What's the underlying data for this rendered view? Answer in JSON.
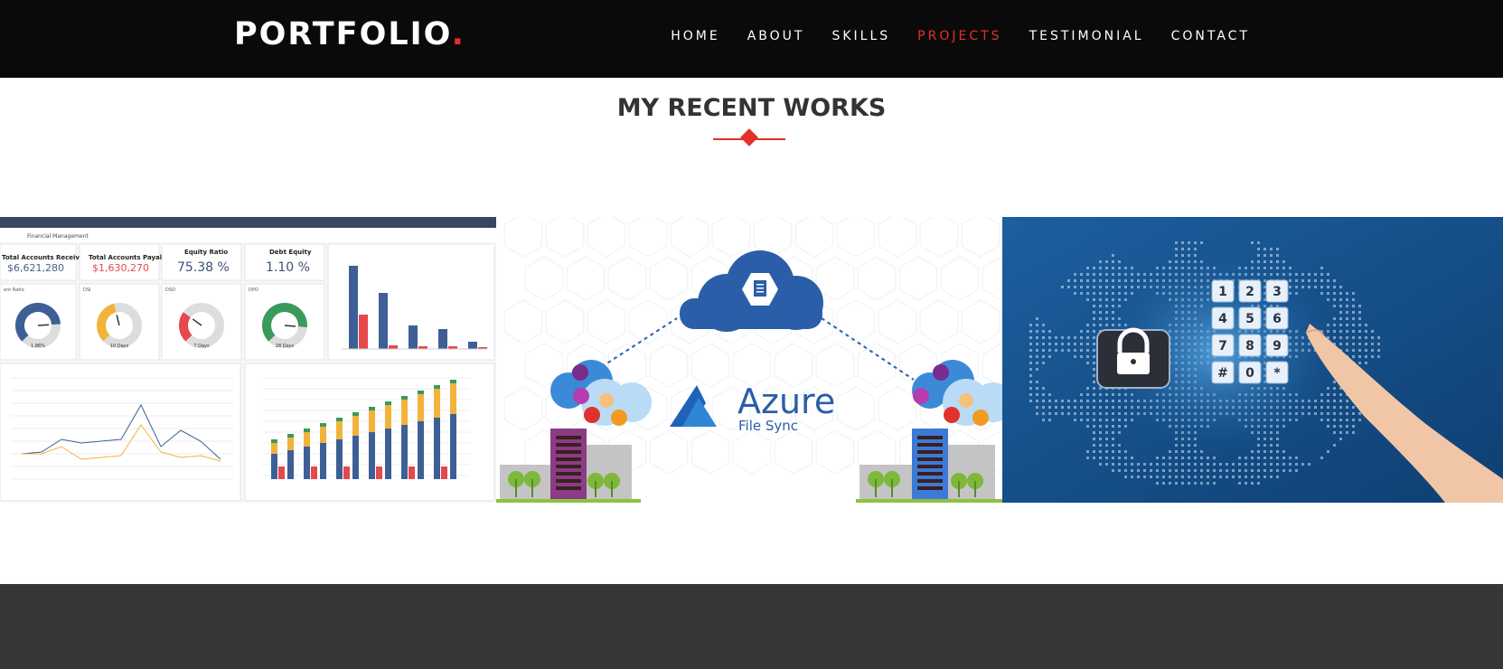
{
  "brand": {
    "name": "PORTFOLIO",
    "dot": ".",
    "accent_color": "#e5302a"
  },
  "nav": {
    "items": [
      {
        "label": "HOME",
        "active": false
      },
      {
        "label": "ABOUT",
        "active": false
      },
      {
        "label": "SKILLS",
        "active": false
      },
      {
        "label": "PROJECTS",
        "active": true
      },
      {
        "label": "TESTIMONIAL",
        "active": false
      },
      {
        "label": "CONTACT",
        "active": false
      }
    ]
  },
  "section": {
    "title": "MY RECENT WORKS"
  },
  "projects": {
    "dashboard": {
      "header": "Financial Management",
      "kpis": [
        {
          "label": "Total Accounts Receivable",
          "value": "$6,621,280"
        },
        {
          "label": "Total Accounts Payable",
          "value": "$1,630,270"
        },
        {
          "label": "Equity Ratio",
          "value": "75.38 %"
        },
        {
          "label": "Debt Equity",
          "value": "1.10 %"
        }
      ],
      "gauges": [
        {
          "label": "ent Ratio",
          "value": "1.86%",
          "fraction": 0.82,
          "color": "#3d5f95"
        },
        {
          "label": "DSI",
          "value": "10 Days",
          "fraction": 0.45,
          "color": "#f2b33d"
        },
        {
          "label": "DSO",
          "value": "7 Days",
          "fraction": 0.3,
          "color": "#e5484d"
        },
        {
          "label": "DPO",
          "value": "28 Days",
          "fraction": 0.85,
          "color": "#3a9a5a"
        }
      ]
    },
    "azure": {
      "title": "Azure",
      "subtitle": "File Sync"
    },
    "security": {
      "keys": [
        "1",
        "2",
        "3",
        "4",
        "5",
        "6",
        "7",
        "8",
        "9",
        "#",
        "0",
        "*"
      ]
    }
  }
}
